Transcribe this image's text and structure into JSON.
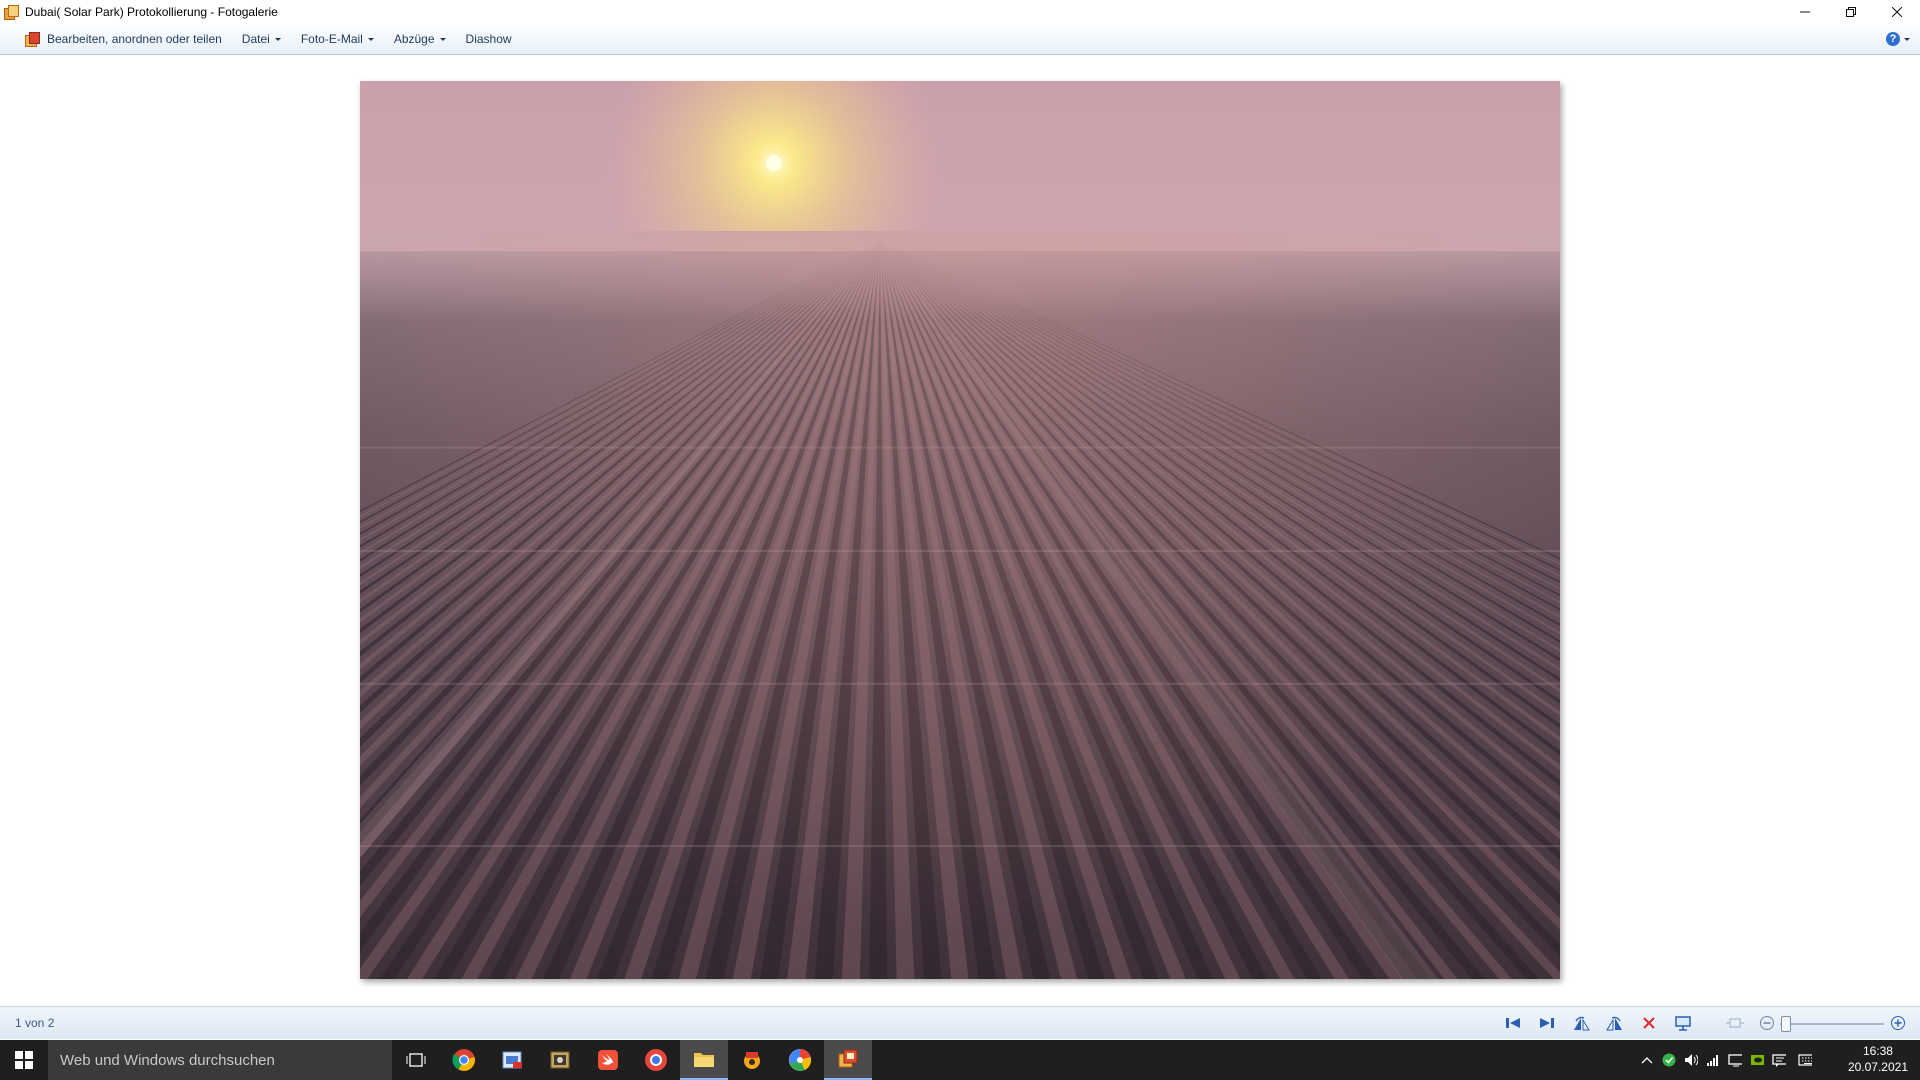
{
  "window": {
    "title": "Dubai( Solar Park) Protokollierung - Fotogalerie",
    "controls": {
      "minimize": "—",
      "restore": "restore",
      "close": "close"
    }
  },
  "menu": {
    "items": [
      {
        "label": "Bearbeiten, anordnen oder teilen",
        "has_dropdown": false,
        "icon": "photo-gallery-icon"
      },
      {
        "label": "Datei",
        "has_dropdown": true
      },
      {
        "label": "Foto-E-Mail",
        "has_dropdown": true
      },
      {
        "label": "Abzüge",
        "has_dropdown": true
      },
      {
        "label": "Diashow",
        "has_dropdown": false
      }
    ],
    "help_icon": "help-icon"
  },
  "photo": {
    "description_icon": "photo-image",
    "sky_colors": [
      "#cf9ea8",
      "#e8b7ad",
      "#f3c9a0"
    ],
    "sun_color": "#fff6a8",
    "ground_colors": [
      "#6d5a63",
      "#51404a",
      "#3b2f38"
    ]
  },
  "status": {
    "counter": "1 von 2",
    "buttons": [
      "previous-icon",
      "next-icon",
      "rotate-left-icon",
      "rotate-right-icon",
      "delete-icon",
      "slideshow-icon",
      "actual-size-icon",
      "zoom-out-icon",
      "zoom-slider",
      "zoom-in-icon"
    ],
    "zoom_level": 0.0
  },
  "taskbar": {
    "search_placeholder": "Web und Windows durchsuchen",
    "apps": [
      "task-view-icon",
      "chrome-icon",
      "pdf-editor-icon",
      "photo-viewer-icon",
      "swift-icon",
      "browser-icon",
      "file-explorer-icon",
      "game-icon",
      "picasa-icon",
      "photo-gallery-icon"
    ],
    "time": "16:38",
    "date": "20.07.2021"
  },
  "colors": {
    "menu_text": "#1e395b",
    "taskbar_bg": "#1f1f1f",
    "accent": "#2f6fd0"
  }
}
